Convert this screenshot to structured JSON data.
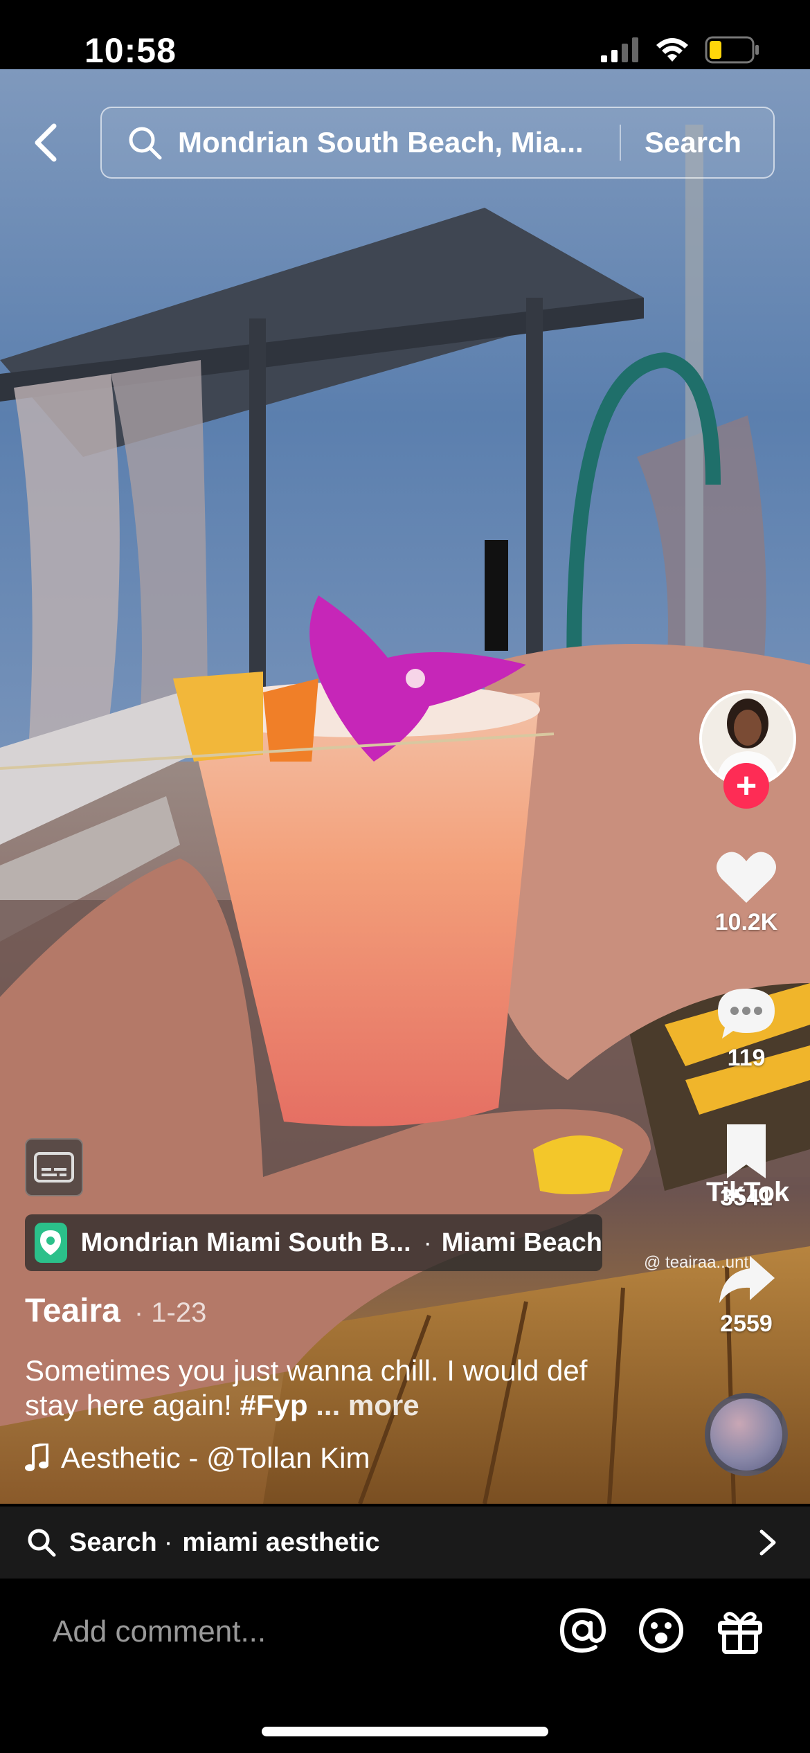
{
  "status_bar": {
    "time": "10:58",
    "battery_level": 0.3
  },
  "search": {
    "query": "Mondrian South Beach, Mia...",
    "button_label": "Search"
  },
  "location": {
    "name": "Mondrian Miami South B...",
    "separator": "·",
    "city": "Miami Beach"
  },
  "engagement": {
    "likes": "10.2K",
    "comments": "119",
    "saves": "3541",
    "shares": "2559"
  },
  "watermark": {
    "brand": "TikTok",
    "handle": "@ teairaa..unt"
  },
  "post": {
    "author": "Teaira",
    "date": "· 1-23",
    "caption_text": "Sometimes you just wanna chill. I would def stay here again! ",
    "hashtag": "#Fyp",
    "more_label": "... more",
    "sound": "Aesthetic - @Tollan Kim"
  },
  "related_search": {
    "label": "Search",
    "separator": "·",
    "term": "miami aesthetic"
  },
  "comment": {
    "placeholder": "Add comment..."
  },
  "colors": {
    "follow_accent": "#fe2c55",
    "location_pin": "#2bc08a"
  },
  "icons": [
    "back-arrow-icon",
    "search-icon",
    "heart-icon",
    "comment-bubble-icon",
    "bookmark-icon",
    "share-arrow-icon",
    "captions-icon",
    "location-pin-icon",
    "music-note-icon",
    "chevron-right-icon",
    "mention-icon",
    "emoji-icon",
    "gift-icon"
  ]
}
